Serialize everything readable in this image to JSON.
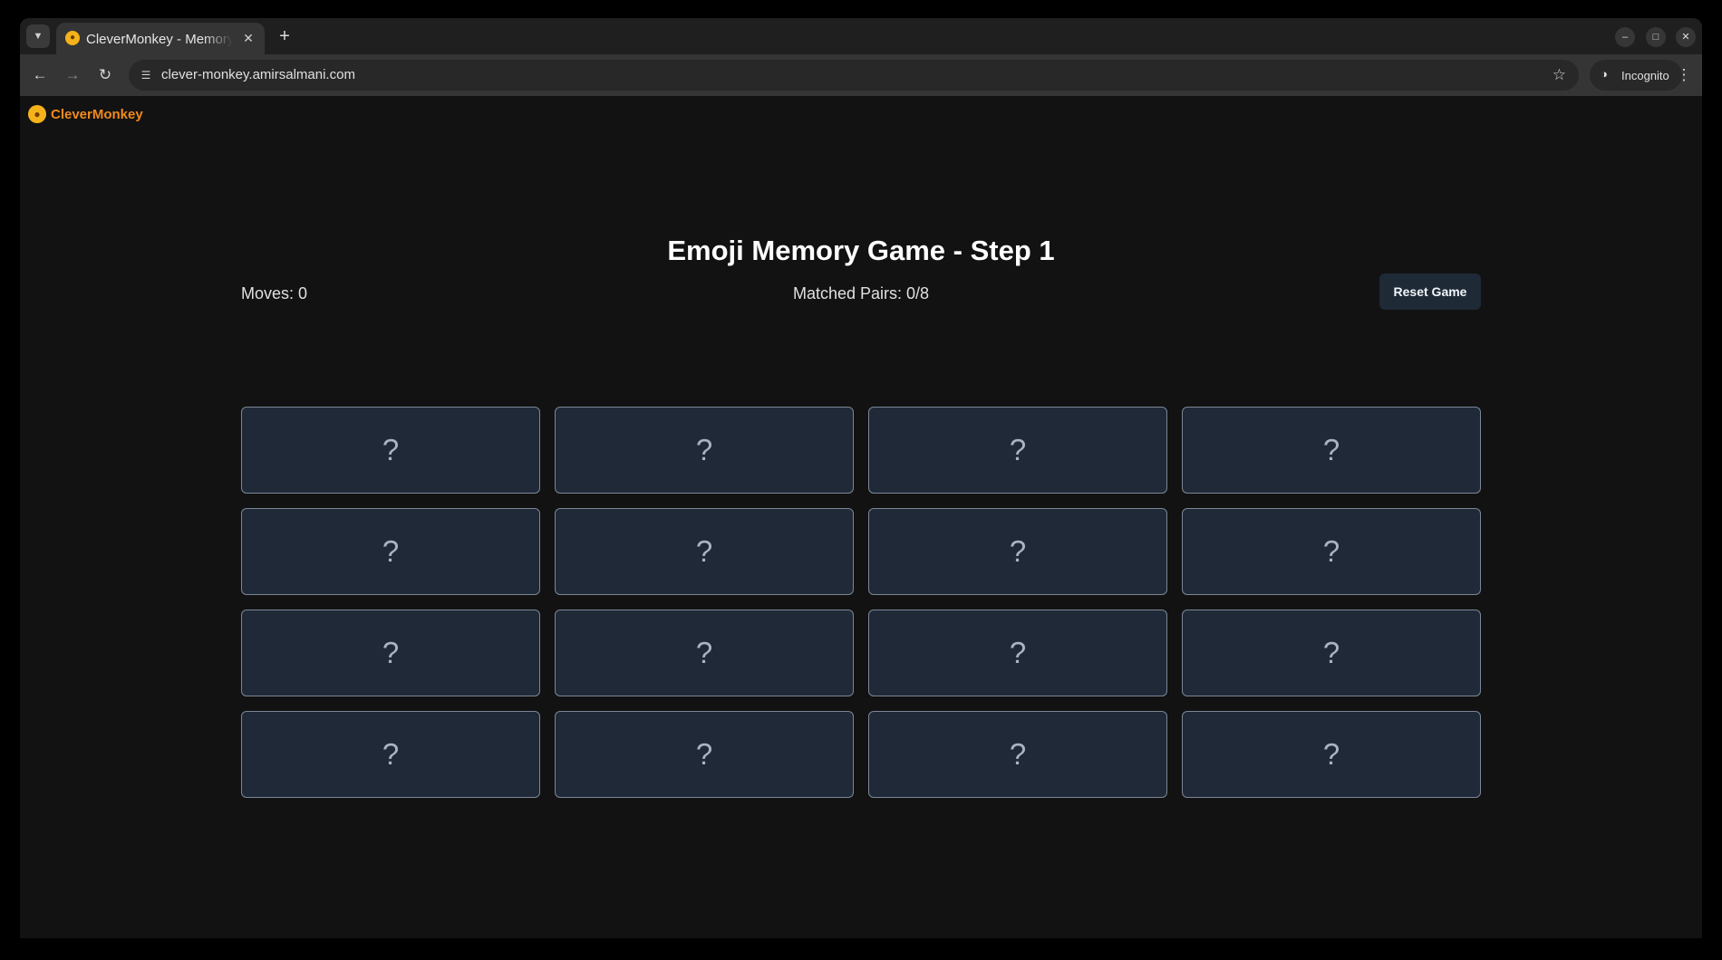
{
  "browser": {
    "tab_title": "CleverMonkey - Memory Game",
    "tab_favicon": "monkey-favicon-icon",
    "url": "clever-monkey.amirsalmani.com",
    "incognito_label": "Incognito"
  },
  "header": {
    "brand_name": "CleverMonkey",
    "brand_icon": "monkey-logo-icon"
  },
  "game": {
    "title": "Emoji Memory Game - Step 1",
    "moves_label": "Moves: 0",
    "pairs_label": "Matched Pairs: 0/8",
    "reset_label": "Reset Game",
    "cards": [
      "?",
      "?",
      "?",
      "?",
      "?",
      "?",
      "?",
      "?",
      "?",
      "?",
      "?",
      "?",
      "?",
      "?",
      "?",
      "?"
    ]
  },
  "colors": {
    "accent": "#f08a1c",
    "card_bg": "#1f2937",
    "page_bg": "#121212"
  }
}
